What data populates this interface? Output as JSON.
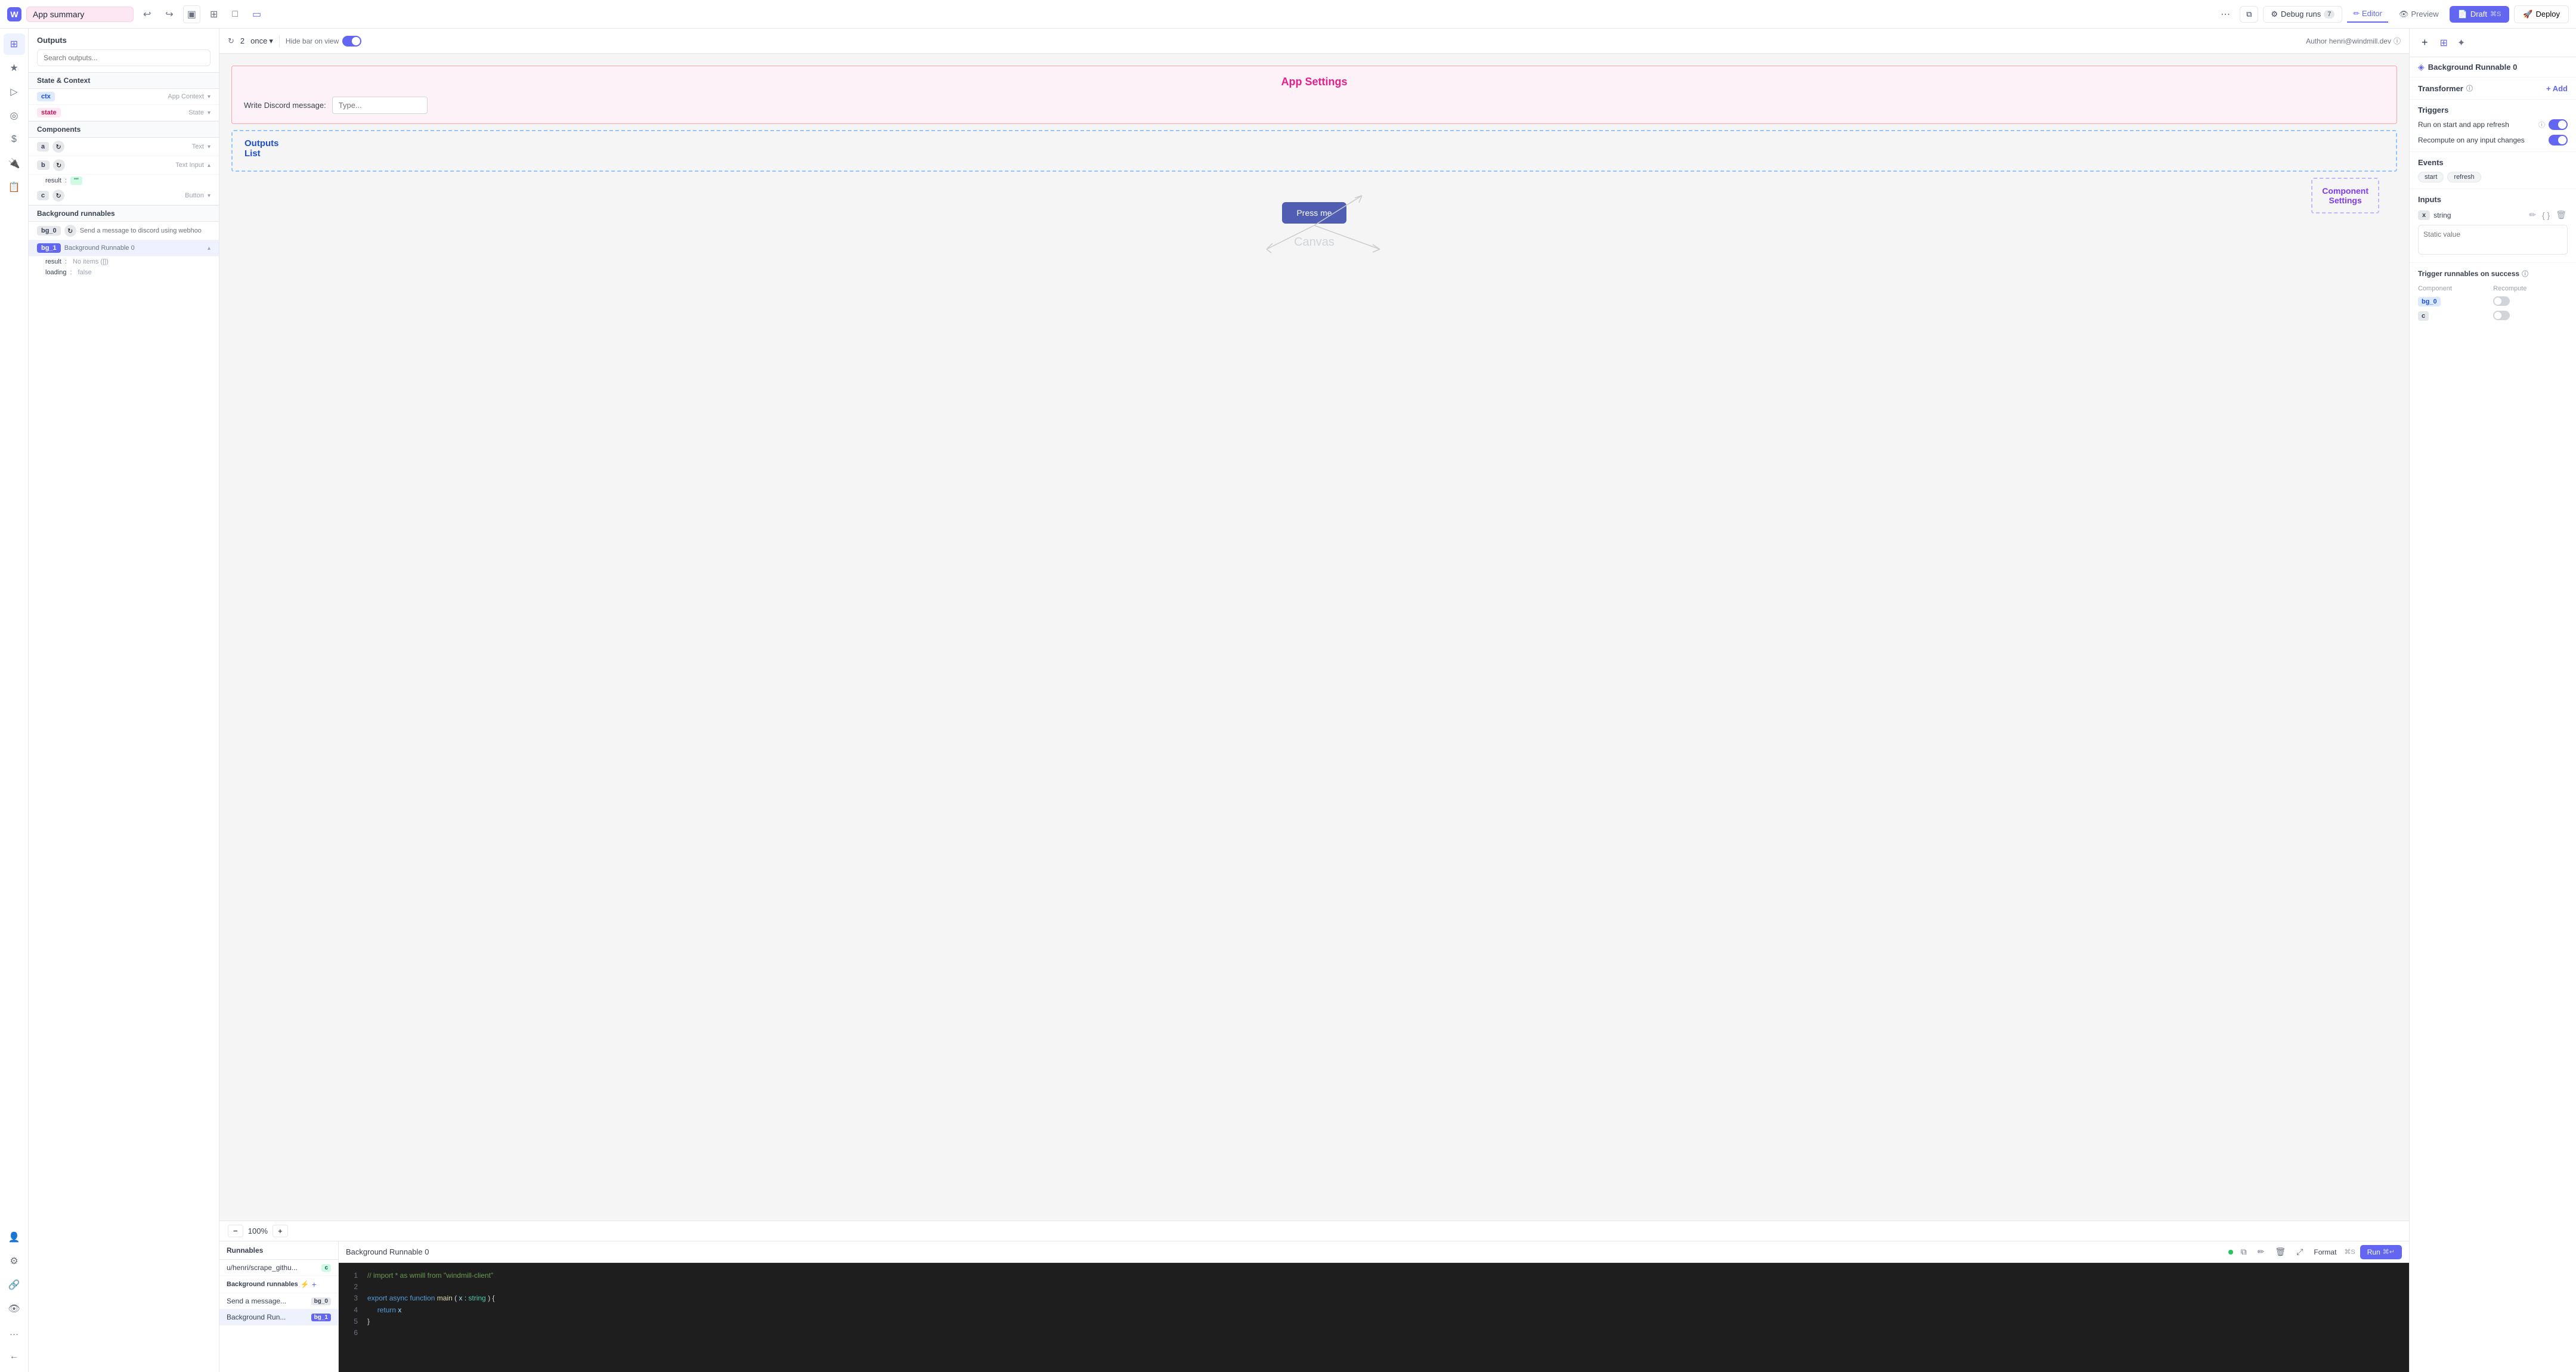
{
  "topbar": {
    "logo": "W",
    "app_name": "App summary",
    "undo_icon": "↩",
    "redo_icon": "↪",
    "view_icons": [
      "▣",
      "⊞",
      "□",
      "▭"
    ],
    "more_icon": "⋯",
    "split_icon": "⧉",
    "debug_label": "Debug runs",
    "debug_count": "7",
    "editor_label": "Editor",
    "preview_label": "Preview",
    "draft_label": "Draft",
    "draft_shortcut": "⌘S",
    "deploy_label": "Deploy"
  },
  "icon_bar": {
    "items": [
      "⊞",
      "★",
      "△",
      "◎",
      "$",
      "🔌",
      "📋",
      "👤",
      "⚙",
      "🔗",
      "👁",
      "…",
      "←"
    ]
  },
  "left_panel": {
    "outputs_label": "Outputs",
    "search_placeholder": "Search outputs...",
    "state_context_label": "State & Context",
    "ctx_tag": "ctx",
    "ctx_label": "App Context",
    "state_tag": "state",
    "state_label": "State",
    "components_label": "Components",
    "component_a": {
      "tag": "a",
      "label": "",
      "type": "Text",
      "has_icon": true
    },
    "component_b": {
      "tag": "b",
      "label": "",
      "type": "Text Input",
      "has_icon": true,
      "expanded": true
    },
    "component_b_result": {
      "key": "result",
      "val": "\"\""
    },
    "component_c": {
      "tag": "c",
      "label": "",
      "type": "Button",
      "has_icon": true
    },
    "bg_runnables_label": "Background runnables",
    "bg0": {
      "tag": "bg_0",
      "label": "Send a message to discord using webhoo",
      "has_icon": true
    },
    "bg1": {
      "tag": "bg_1",
      "label": "Background Runnable 0",
      "selected": true
    },
    "bg1_result_key": "result",
    "bg1_result_val": "No items ([])",
    "bg1_loading_key": "loading",
    "bg1_loading_val": "false"
  },
  "canvas_toolbar": {
    "refresh_icon": "↻",
    "count": "2",
    "frequency": "once",
    "chevron": "▾",
    "hide_bar_label": "Hide bar on view",
    "author_label": "Author henri@windmill.dev",
    "info_icon": "ⓘ"
  },
  "canvas": {
    "app_settings_title": "App Settings",
    "discord_label": "Write Discord message:",
    "discord_placeholder": "Type...",
    "outputs_list_title": "Outputs\nList",
    "component_settings_title": "Component\nSettings",
    "press_me_label": "Press me",
    "canvas_label": "Canvas"
  },
  "zoom": {
    "minus": "−",
    "value": "100%",
    "plus": "+"
  },
  "runnables_panel": {
    "header": "Runnables",
    "items": [
      {
        "name": "u/henri/scrape_githu...",
        "tag": "c"
      }
    ],
    "bg_header": "Background runnables",
    "add_icon": "+",
    "bg_items": [
      {
        "name": "Send a message...",
        "tag": "bg_0"
      },
      {
        "name": "Background Run...",
        "tag": "bg_1",
        "selected": true
      }
    ]
  },
  "editor": {
    "title": "Background Runnable 0",
    "format_label": "Format",
    "format_shortcut": "⌘S",
    "run_label": "Run",
    "run_shortcut": "⌘↵",
    "code": [
      {
        "num": 1,
        "content": "// import * as wmill from \"windmill-client\"",
        "type": "comment"
      },
      {
        "num": 2,
        "content": "",
        "type": "empty"
      },
      {
        "num": 3,
        "content": "export async function main(x: string) {",
        "type": "code"
      },
      {
        "num": 4,
        "content": "    return x",
        "type": "code"
      },
      {
        "num": 5,
        "content": "}",
        "type": "code"
      },
      {
        "num": 6,
        "content": "",
        "type": "empty"
      }
    ]
  },
  "right_panel": {
    "add_icon": "+",
    "add_label": "Add",
    "bg_runnable_name": "Background Runnable 0",
    "transformer_label": "Transformer",
    "triggers_label": "Triggers",
    "trigger_1_label": "Run on start and app refresh",
    "trigger_2_label": "Recompute on any input changes",
    "events_label": "Events",
    "event_1": "start",
    "event_2": "refresh",
    "inputs_label": "Inputs",
    "x_tag": "x",
    "string_type": "string",
    "static_value_placeholder": "Static value",
    "success_label": "Trigger runnables on success",
    "success_cols": [
      "Component",
      "Recompute"
    ],
    "success_rows": [
      {
        "component": "bg_0",
        "recompute": false
      },
      {
        "component": "c",
        "recompute": false
      }
    ]
  }
}
